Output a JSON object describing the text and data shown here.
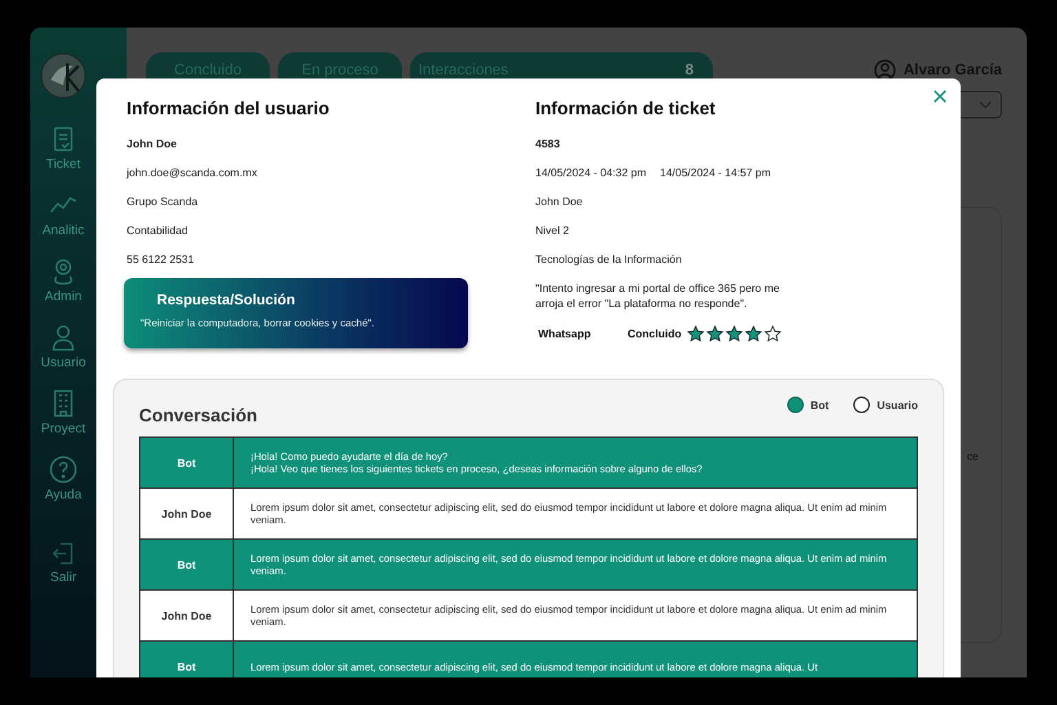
{
  "sidebar": {
    "items": [
      {
        "label": "Ticket"
      },
      {
        "label": "Analitic"
      },
      {
        "label": "Admin"
      },
      {
        "label": "Usuario"
      },
      {
        "label": "Proyect"
      },
      {
        "label": "Ayuda"
      }
    ],
    "footer": {
      "label": "Salir"
    }
  },
  "header": {
    "tabs": [
      {
        "label": "Concluido"
      },
      {
        "label": "En proceso"
      },
      {
        "label": "Interacciones",
        "count": "8"
      }
    ],
    "user": "Alvaro García"
  },
  "background_text": "ce",
  "modal": {
    "user_info": {
      "title": "Información del usuario",
      "name": "John Doe",
      "email": "john.doe@scanda.com.mx",
      "company": "Grupo Scanda",
      "department": "Contabilidad",
      "phone": "55 6122 2531"
    },
    "solution": {
      "title": "Respuesta/Solución",
      "text": "\"Reiniciar la computadora, borrar cookies y caché\"."
    },
    "ticket_info": {
      "title": "Información de ticket",
      "id": "4583",
      "opened": "14/05/2024 - 04:32 pm",
      "closed": "14/05/2024 - 14:57 pm",
      "user": "John Doe",
      "level": "Nivel 2",
      "area": "Tecnologías de la Información",
      "description": "\"Intento ingresar a mi portal de office 365 pero me arroja el error \"La plataforma no responde\".",
      "channel": "Whatsapp",
      "status": "Concluido",
      "stars": 4
    },
    "conversation": {
      "title": "Conversación",
      "filters": [
        {
          "label": "Bot",
          "selected": true
        },
        {
          "label": "Usuario",
          "selected": false
        }
      ],
      "rows": [
        {
          "kind": "bot",
          "sender": "Bot",
          "lines": [
            "¡Hola! Como puedo ayudarte el día de hoy?",
            "¡Hola! Veo que tienes los siguientes tickets en proceso, ¿deseas información sobre alguno de ellos?"
          ]
        },
        {
          "kind": "user",
          "sender": "John Doe",
          "lines": [
            "Lorem ipsum dolor sit amet, consectetur adipiscing elit, sed do eiusmod tempor incididunt ut labore et dolore magna aliqua. Ut enim ad minim veniam."
          ]
        },
        {
          "kind": "bot",
          "sender": "Bot",
          "lines": [
            "Lorem ipsum dolor sit amet, consectetur adipiscing elit, sed do eiusmod tempor incididunt ut labore et dolore magna aliqua. Ut enim ad minim veniam."
          ]
        },
        {
          "kind": "user",
          "sender": "John Doe",
          "lines": [
            "Lorem ipsum dolor sit amet, consectetur adipiscing elit, sed do eiusmod tempor incididunt ut labore et dolore magna aliqua. Ut enim ad minim veniam."
          ]
        },
        {
          "kind": "bot",
          "sender": "Bot",
          "lines": [
            "Lorem ipsum dolor sit amet, consectetur adipiscing elit, sed do eiusmod tempor incididunt ut labore et dolore magna aliqua. Ut"
          ]
        }
      ]
    }
  }
}
